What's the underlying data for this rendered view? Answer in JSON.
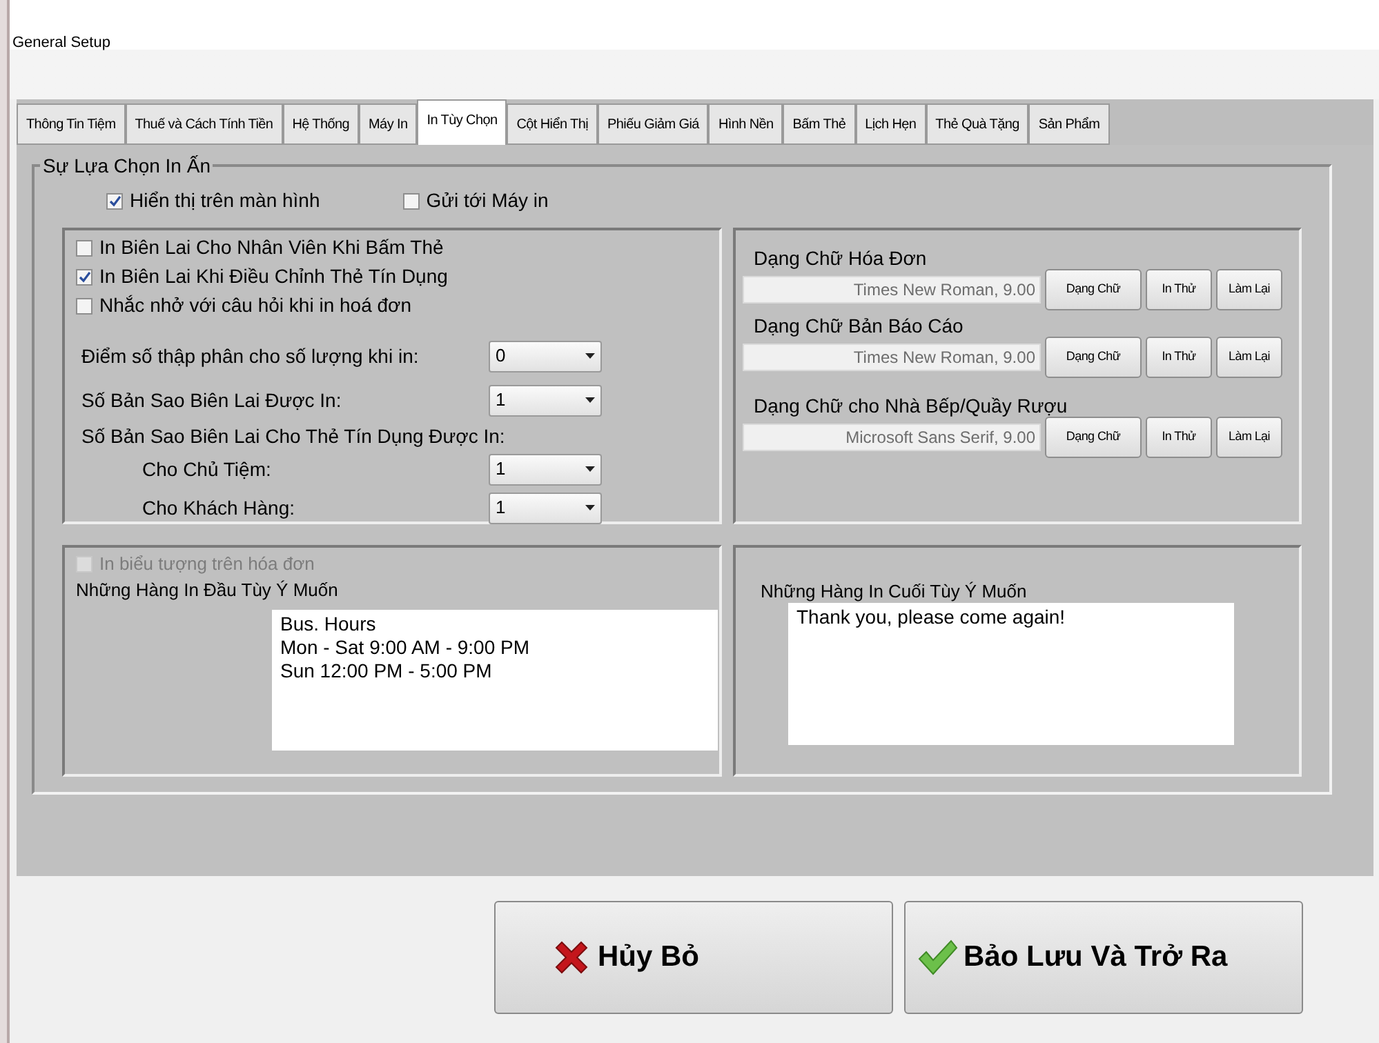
{
  "window": {
    "title": "General Setup"
  },
  "tabs": [
    {
      "label": "Thông Tin Tiệm",
      "selected": false
    },
    {
      "label": "Thuế và Cách Tính Tiền",
      "selected": false
    },
    {
      "label": "Hệ Thống",
      "selected": false
    },
    {
      "label": "Máy In",
      "selected": false
    },
    {
      "label": "In Tùy Chọn",
      "selected": true
    },
    {
      "label": "Cột Hiển Thị",
      "selected": false
    },
    {
      "label": "Phiếu Giảm Giá",
      "selected": false
    },
    {
      "label": "Hình Nền",
      "selected": false
    },
    {
      "label": "Bấm Thẻ",
      "selected": false
    },
    {
      "label": "Lịch Hẹn",
      "selected": false
    },
    {
      "label": "Thẻ Quà Tặng",
      "selected": false
    },
    {
      "label": "Sản Phẩm",
      "selected": false
    }
  ],
  "group": {
    "title": "Sự Lựa Chọn In Ấn"
  },
  "display_options": [
    {
      "label": "Hiển thị trên màn hình",
      "checked": true
    },
    {
      "label": "Gửi tới Máy in",
      "checked": false
    }
  ],
  "receipt_options": [
    {
      "label": "In Biên Lai Cho Nhân Viên Khi Bấm Thẻ",
      "checked": false
    },
    {
      "label": "In Biên Lai Khi Điều Chỉnh Thẻ Tín Dụng",
      "checked": true
    },
    {
      "label": "Nhắc nhở với câu hỏi khi in hoá đơn",
      "checked": false
    }
  ],
  "copy_settings": [
    {
      "kind": "select",
      "label": "Điểm số thập phân cho số lượng khi in:",
      "value": "0"
    },
    {
      "kind": "select",
      "label": "Số Bản Sao Biên Lai Được In:",
      "value": "1"
    },
    {
      "kind": "heading",
      "label": "Số Bản Sao Biên Lai Cho Thẻ Tín Dụng Được In:"
    },
    {
      "kind": "subselect",
      "label": "Cho Chủ Tiệm:",
      "value": "1"
    },
    {
      "kind": "subselect",
      "label": "Cho Khách Hàng:",
      "value": "1"
    }
  ],
  "fonts": [
    {
      "label": "Dạng Chữ Hóa Đơn",
      "value": "Times New Roman, 9.00",
      "buttons": [
        "Dạng Chữ",
        "In Thử",
        "Làm Lại"
      ]
    },
    {
      "label": "Dạng Chữ Bản Báo Cáo",
      "value": "Times New Roman, 9.00",
      "buttons": [
        "Dạng Chữ",
        "In Thử",
        "Làm Lại"
      ]
    },
    {
      "label": "Dạng Chữ cho Nhà Bếp/Quầy Rượu",
      "value": "Microsoft Sans Serif, 9.00",
      "buttons": [
        "Dạng Chữ",
        "In Thử",
        "Làm Lại"
      ]
    }
  ],
  "logo_option": {
    "label": "In biểu tượng trên hóa đơn",
    "checked": false,
    "disabled": true
  },
  "header_lines": {
    "label": "Những Hàng In Đầu Tùy Ý Muốn",
    "lines": [
      "Bus. Hours",
      "Mon - Sat 9:00 AM - 9:00 PM",
      "Sun 12:00 PM - 5:00 PM"
    ]
  },
  "footer_lines": {
    "label": "Những Hàng In Cuối Tùy Ý Muốn",
    "lines": [
      "Thank you, please come again!"
    ]
  },
  "buttons": [
    {
      "kind": "cancel",
      "label": "Hủy Bỏ"
    },
    {
      "kind": "save",
      "label": "Bảo Lưu Và Trở Ra"
    }
  ]
}
